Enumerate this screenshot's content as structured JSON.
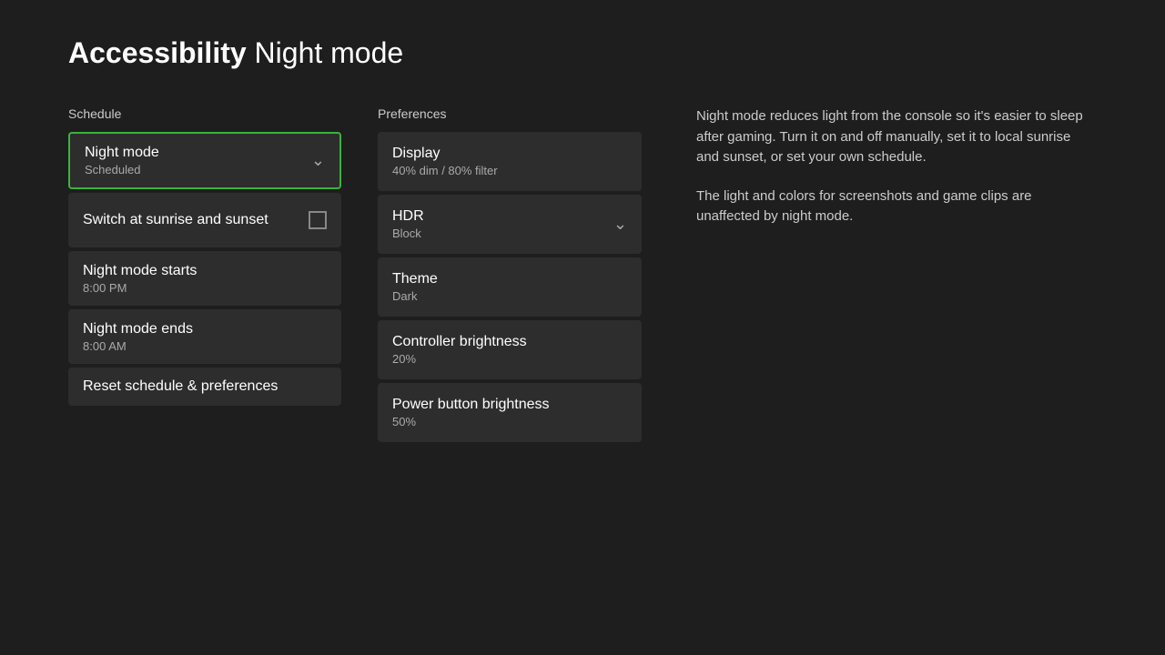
{
  "header": {
    "title_bold": "Accessibility",
    "title_normal": "Night mode"
  },
  "schedule": {
    "section_label": "Schedule",
    "items": [
      {
        "id": "night-mode",
        "title": "Night mode",
        "subtitle": "Scheduled",
        "has_chevron": true,
        "selected": true
      },
      {
        "id": "sunrise-sunset",
        "title": "Switch at sunrise and sunset",
        "subtitle": "",
        "has_checkbox": true,
        "checked": false
      },
      {
        "id": "night-mode-starts",
        "title": "Night mode starts",
        "subtitle": "8:00 PM",
        "has_chevron": false
      },
      {
        "id": "night-mode-ends",
        "title": "Night mode ends",
        "subtitle": "8:00 AM",
        "has_chevron": false
      }
    ],
    "reset_label": "Reset schedule & preferences"
  },
  "preferences": {
    "section_label": "Preferences",
    "items": [
      {
        "id": "display",
        "title": "Display",
        "subtitle": "40% dim / 80% filter",
        "has_chevron": false
      },
      {
        "id": "hdr",
        "title": "HDR",
        "subtitle": "Block",
        "has_chevron": true
      },
      {
        "id": "theme",
        "title": "Theme",
        "subtitle": "Dark",
        "has_chevron": false
      },
      {
        "id": "controller-brightness",
        "title": "Controller brightness",
        "subtitle": "20%",
        "has_chevron": false
      },
      {
        "id": "power-button-brightness",
        "title": "Power button brightness",
        "subtitle": "50%",
        "has_chevron": false
      }
    ]
  },
  "info": {
    "paragraph1": "Night mode reduces light from the console so it's easier to sleep after gaming. Turn it on and off manually, set it to local sunrise and sunset, or set your own schedule.",
    "paragraph2": "The light and colors for screenshots and game clips are unaffected by night mode."
  },
  "icons": {
    "chevron": "∨",
    "checkbox_empty": ""
  }
}
